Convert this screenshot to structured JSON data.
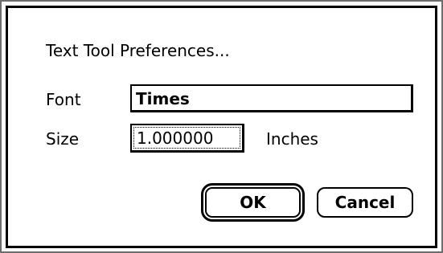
{
  "dialog": {
    "title": "Text Tool Preferences...",
    "font": {
      "label": "Font",
      "value": "Times"
    },
    "size": {
      "label": "Size",
      "value": "1.000000",
      "units": "Inches"
    },
    "buttons": {
      "ok_label": "OK",
      "cancel_label": "Cancel"
    }
  },
  "colors": {
    "background": "#ffffff",
    "border": "#000000",
    "outer_border": "#6e6e6e"
  }
}
